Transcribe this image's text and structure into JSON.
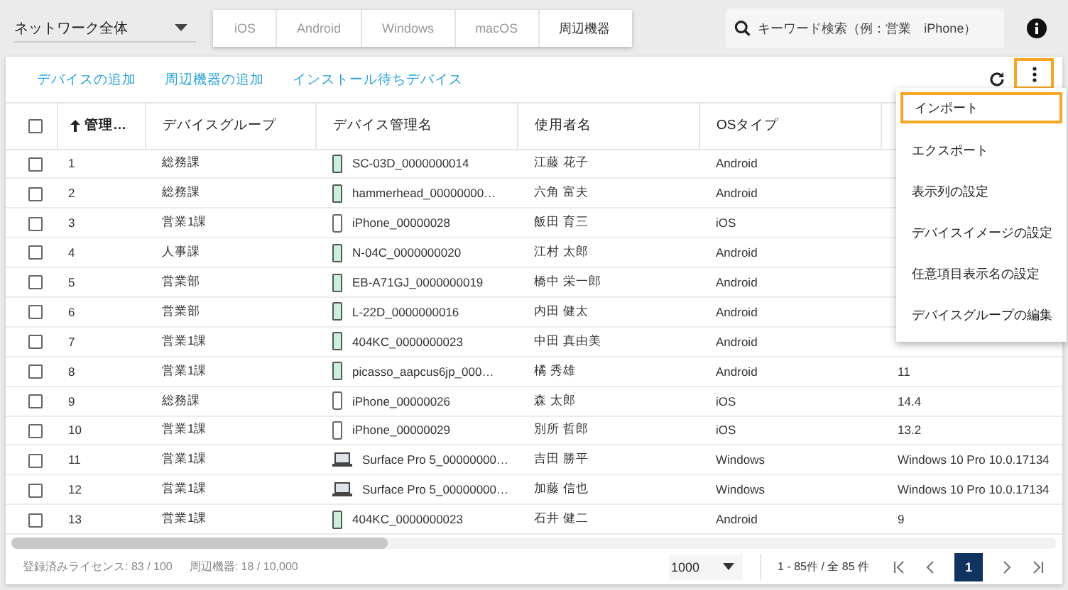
{
  "network_select": {
    "value": "ネットワーク全体"
  },
  "os_filters": [
    {
      "label": "iOS",
      "dimmed": true
    },
    {
      "label": "Android",
      "dimmed": true
    },
    {
      "label": "Windows",
      "dimmed": true
    },
    {
      "label": "macOS",
      "dimmed": true
    },
    {
      "label": "周辺機器",
      "dimmed": false
    }
  ],
  "search": {
    "placeholder": "キーワード検索（例：営業　iPhone）"
  },
  "actions": [
    "デバイスの追加",
    "周辺機器の追加",
    "インストール待ちデバイス"
  ],
  "table": {
    "all_checked": false,
    "columns": [
      {
        "label": "管理…",
        "sort_ascending": true
      },
      {
        "label": "デバイスグループ"
      },
      {
        "label": "デバイス管理名"
      },
      {
        "label": "使用者名"
      },
      {
        "label": "OSタイプ"
      }
    ],
    "rows": [
      {
        "checked": false,
        "no": "1",
        "group": "総務課",
        "kind": "android",
        "name": "SC-03D_0000000014",
        "user": "江藤 花子",
        "os": "Android"
      },
      {
        "checked": false,
        "no": "2",
        "group": "総務課",
        "kind": "android",
        "name": "hammerhead_00000000…",
        "user": "六角 富夫",
        "os": "Android"
      },
      {
        "checked": false,
        "no": "3",
        "group": "営業1課",
        "kind": "iphone",
        "name": "iPhone_00000028",
        "user": "飯田 育三",
        "os": "iOS"
      },
      {
        "checked": false,
        "no": "4",
        "group": "人事課",
        "kind": "android",
        "name": "N-04C_0000000020",
        "user": "江村 太郎",
        "os": "Android"
      },
      {
        "checked": false,
        "no": "5",
        "group": "営業部",
        "kind": "android",
        "name": "EB-A71GJ_0000000019",
        "user": "橋中 栄一郎",
        "os": "Android"
      },
      {
        "checked": false,
        "no": "6",
        "group": "営業部",
        "kind": "android",
        "name": "L-22D_0000000016",
        "user": "内田 健太",
        "os": "Android"
      },
      {
        "checked": false,
        "no": "7",
        "group": "営業1課",
        "kind": "android",
        "name": "404KC_0000000023",
        "user": "中田 真由美",
        "os": "Android"
      },
      {
        "checked": false,
        "no": "8",
        "group": "営業1課",
        "kind": "android",
        "name": "picasso_aapcus6jp_000…",
        "user": "橘 秀雄",
        "os": "Android",
        "os_version": "11"
      },
      {
        "checked": false,
        "no": "9",
        "group": "総務課",
        "kind": "iphone",
        "name": "iPhone_00000026",
        "user": "森 太郎",
        "os": "iOS",
        "os_version": "14.4"
      },
      {
        "checked": false,
        "no": "10",
        "group": "営業1課",
        "kind": "iphone",
        "name": "iPhone_00000029",
        "user": "別所 哲郎",
        "os": "iOS",
        "os_version": "13.2"
      },
      {
        "checked": false,
        "no": "11",
        "group": "営業1課",
        "kind": "laptop",
        "name": "Surface Pro 5_00000000…",
        "user": "吉田 勝平",
        "os": "Windows",
        "os_version": "Windows 10 Pro 10.0.17134"
      },
      {
        "checked": false,
        "no": "12",
        "group": "営業1課",
        "kind": "laptop",
        "name": "Surface Pro 5_00000000…",
        "user": "加藤 信也",
        "os": "Windows",
        "os_version": "Windows 10 Pro 10.0.17134"
      },
      {
        "checked": false,
        "no": "13",
        "group": "営業1課",
        "kind": "android",
        "name": "404KC_0000000023",
        "user": "石井 健二",
        "os": "Android",
        "os_version": "9"
      }
    ]
  },
  "menu": {
    "items": [
      {
        "label": "インポート",
        "highlighted": true
      },
      {
        "label": "エクスポート",
        "highlighted": false
      },
      {
        "label": "表示列の設定",
        "highlighted": false
      },
      {
        "label": "デバイスイメージの設定",
        "highlighted": false
      },
      {
        "label": "任意項目表示名の設定",
        "highlighted": false
      },
      {
        "label": "デバイスグループの編集",
        "highlighted": false
      }
    ]
  },
  "footer": {
    "licenses": "登録済みライセンス: 83 / 100",
    "peripherals": "周辺機器: 18 / 10,000",
    "per_page": "1000",
    "range": "1 - 85件 / 全 85 件",
    "pages": [
      {
        "label": "1",
        "selected": true
      }
    ]
  }
}
